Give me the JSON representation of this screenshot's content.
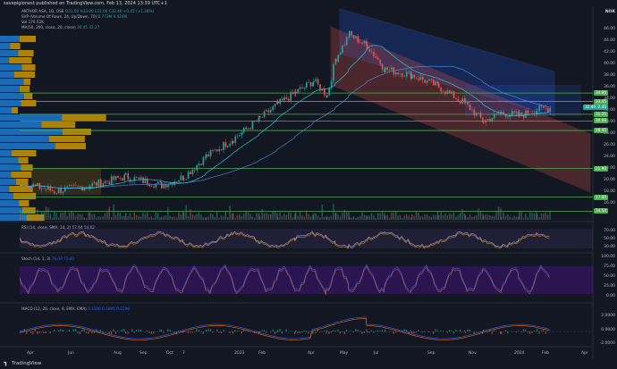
{
  "header": {
    "publisher_line": "savepigionest published on TradingView.com, Feb 13, 2024 13:39 UTC+1"
  },
  "main_pane": {
    "symbol": "ANTHOR ASA, 1D, OSE",
    "ohlc": "O31.00 H33.00 L31.00 C32.40 +0.45 (+1.38%)",
    "volume_profile": "SVP (Volume Of Rows, 24, Up/Down, 70)",
    "volume_profile_values": "8.773M 9.424M",
    "vol_label": "Vol 170.52K",
    "ma_label": "MA(50, 200, close, 20, close)",
    "ma_values": "36.45 32.27",
    "price_axis_currency": "NOK",
    "price_ticks": [
      "46.00",
      "44.00",
      "42.00",
      "40.00",
      "38.00",
      "36.00",
      "34.00",
      "32.00",
      "30.00",
      "28.00",
      "26.00",
      "24.00",
      "22.00",
      "20.00",
      "18.00",
      "16.00"
    ],
    "level_tags": [
      {
        "value": "34.90",
        "color": "#4caf50"
      },
      {
        "value": "33.45",
        "color": "#4caf50"
      },
      {
        "value": "32.40",
        "color": "#26a69a"
      },
      {
        "value": "31.25",
        "color": "#4caf50"
      },
      {
        "value": "30.08",
        "color": "#4caf50"
      },
      {
        "value": "28.45",
        "color": "#4caf50"
      },
      {
        "value": "21.90",
        "color": "#4caf50"
      },
      {
        "value": "17.00",
        "color": "#4caf50"
      },
      {
        "value": "14.54",
        "color": "#4caf50"
      }
    ],
    "last_price": "32.40"
  },
  "rsi_pane": {
    "label": "RSI (14, close, SMA, 14, 2)",
    "values": "57.64 54.62",
    "ticks": [
      "70.00",
      "50.00",
      "30.00"
    ]
  },
  "stoch_pane": {
    "label": "Stoch (14, 1, 3)",
    "values": "76.09 73.85",
    "ticks": [
      "100.00",
      "75.00",
      "50.00",
      "25.00",
      "0.00"
    ]
  },
  "macd_pane": {
    "label": "MACD (12, 26, close, 9, EMA, EMA)",
    "values": "0.1206 0.1895 0.2298",
    "ticks": [
      "2.0000",
      "0.0000",
      "-2.0000"
    ]
  },
  "time_axis": [
    "Apr",
    "Jun",
    "Aug",
    "Sep",
    "Oct",
    "7",
    "2023",
    "Feb",
    "Apr",
    "May",
    "Jul",
    "Sep",
    "Nov",
    "2024",
    "Feb",
    "Apr"
  ],
  "footer": {
    "brand": "TradingView"
  },
  "colors": {
    "background": "#131722",
    "up": "#26a69a",
    "down": "#ef5350",
    "level": "#4caf50",
    "rsi_fill": "#7e57c2",
    "vp_up": "#1e88e5",
    "vp_down": "#e0a800"
  }
}
